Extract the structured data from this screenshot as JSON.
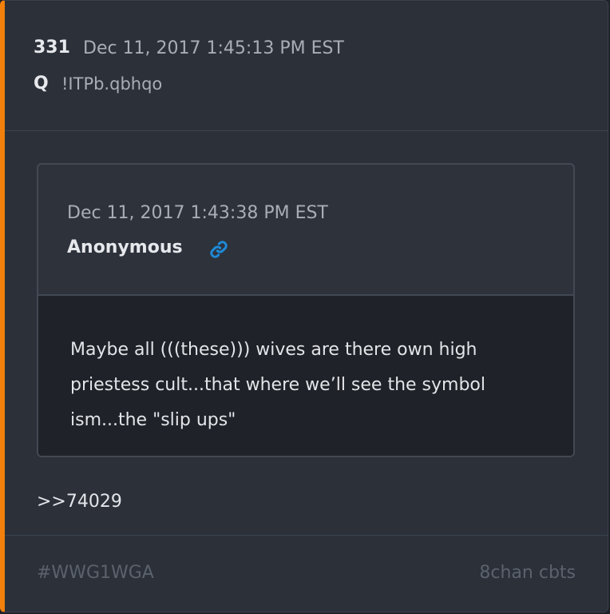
{
  "post": {
    "number": "331",
    "timestamp": "Dec 11, 2017 1:45:13 PM EST",
    "author": "Q",
    "tripcode": "!ITPb.qbhqo"
  },
  "quoted_post": {
    "timestamp": "Dec 11, 2017 1:43:38 PM EST",
    "author": "Anonymous",
    "link_icon": "link-icon",
    "text": "Maybe all (((these))) wives  are there own high priestess cult...that where we’ll see the symbol ism...the \"slip ups\""
  },
  "reply_ref": ">>74029",
  "footer": {
    "hashtag": "#WWG1WGA",
    "source": "8chan cbts"
  },
  "colors": {
    "accent": "#f2800a",
    "link": "#1e8ad6"
  }
}
